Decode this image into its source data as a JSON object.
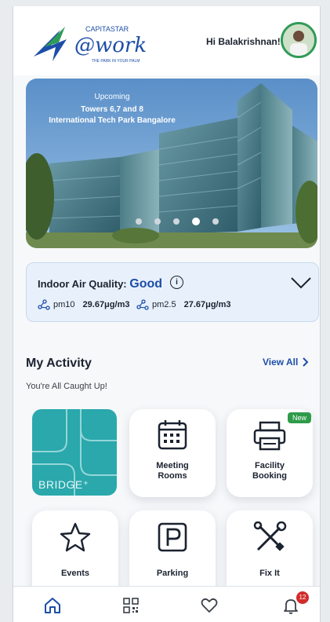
{
  "header": {
    "logo_brand": "CAPITASTAR",
    "logo_wordmark": "@work",
    "logo_tagline": "THE PARK IN YOUR PALM",
    "greeting": "Hi Balakrishnan!"
  },
  "banner": {
    "status": "Upcoming",
    "line1": "Towers 6,7 and 8",
    "line2": "International Tech Park Bangalore",
    "slide_count": 5,
    "active_slide": 4
  },
  "air_quality": {
    "label": "Indoor Air Quality:",
    "value": "Good",
    "info_glyph": "i",
    "pm10_label": "pm10",
    "pm10_value": "29.67μg/m3",
    "pm25_label": "pm2.5",
    "pm25_value": "27.67μg/m3"
  },
  "activity": {
    "title": "My Activity",
    "view_all": "View All",
    "status": "You're All Caught Up!"
  },
  "tiles": {
    "bridge": "BRIDGE⁺",
    "meeting_rooms": {
      "line1": "Meeting",
      "line2": "Rooms"
    },
    "facility_booking": {
      "line1": "Facility",
      "line2": "Booking",
      "badge": "New"
    },
    "events": "Events",
    "parking": "Parking",
    "fix_it": "Fix It"
  },
  "bottom_nav": {
    "notifications_count": "12",
    "icons": [
      "home-icon",
      "qr-code-icon",
      "heart-icon",
      "bell-icon"
    ]
  },
  "colors": {
    "brand_blue": "#1d4ea8",
    "logo_green": "#2f9b57",
    "badge_green": "#2e9b49",
    "bridge_teal": "#2aa8ac",
    "notification_red": "#d22b2b"
  }
}
